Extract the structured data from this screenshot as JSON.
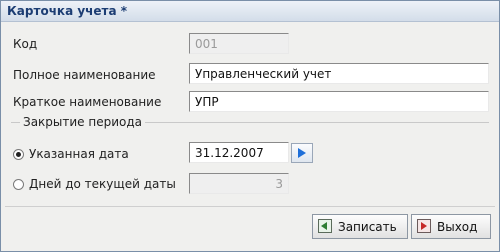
{
  "window": {
    "title": "Карточка учета *"
  },
  "form": {
    "code_label": "Код",
    "code_value": "001",
    "full_name_label": "Полное наименование",
    "full_name_value": "Управленческий учет",
    "short_name_label": "Краткое наименование",
    "short_name_value": "УПР"
  },
  "period": {
    "group_title": "Закрытие периода",
    "option_date_label": "Указанная дата",
    "option_date_checked": true,
    "date_value": "31.12.2007",
    "option_days_label": "Дней до текущей даты",
    "option_days_checked": false,
    "days_value": "3"
  },
  "buttons": {
    "save_label": "Записать",
    "exit_label": "Выход"
  },
  "colors": {
    "title_text": "#1c3d73",
    "save_icon": "#2e7d32",
    "exit_icon": "#c62828",
    "arrow_icon": "#1e6fd9"
  },
  "icons": {
    "date_picker": "play-arrow-icon",
    "save": "save-icon",
    "exit": "exit-icon"
  }
}
